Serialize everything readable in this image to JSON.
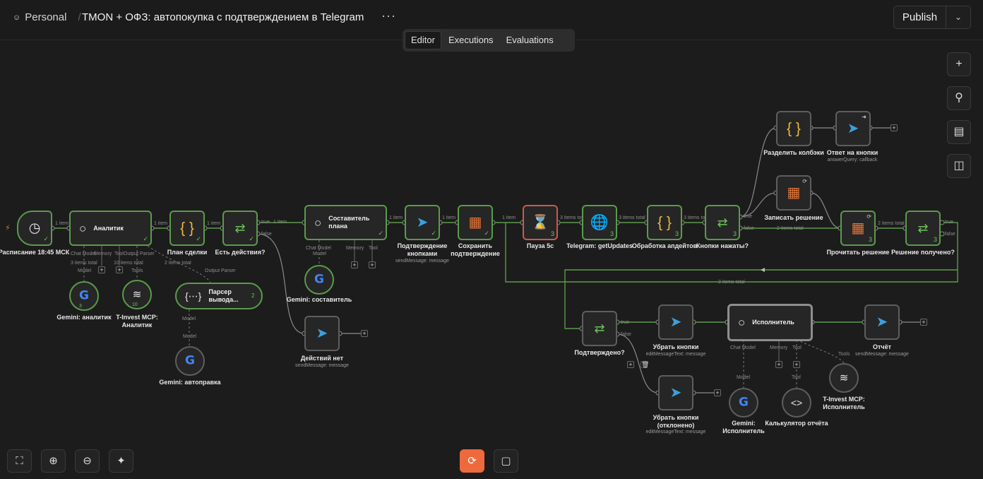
{
  "header": {
    "workspace": "Personal",
    "title": "TMON + ОФЗ: автопокупка с подтверждением в Telegram",
    "more": "···",
    "publish": "Publish",
    "publish_menu": "⌄"
  },
  "tabs": [
    {
      "label": "Editor",
      "active": true
    },
    {
      "label": "Executions",
      "active": false
    },
    {
      "label": "Evaluations",
      "active": false
    }
  ],
  "nodes": {
    "schedule": {
      "label": "Расписание 18:45 МСК"
    },
    "analyst": {
      "label": "Аналитик",
      "p1": "Chat Model",
      "p2": "Memory",
      "p3": "Tool",
      "p4": "Output Parser"
    },
    "plan": {
      "label": "План сделки"
    },
    "has_actions": {
      "label": "Есть действия?"
    },
    "gemini_analyst": {
      "label": "Gemini: аналитик",
      "count": "3"
    },
    "tinvest_analyst": {
      "label": "T-Invest MCP:",
      "label2": "Аналитик",
      "count": "10"
    },
    "parser": {
      "label": "Парсер",
      "label2": "вывода...",
      "count": "2",
      "p1": "Model"
    },
    "gemini_autofix": {
      "label": "Gemini: автоправка"
    },
    "composer": {
      "label": "Составитель",
      "label2": "плана",
      "p1": "Chat Model",
      "p2": "Memory",
      "p3": "Tool"
    },
    "gemini_composer": {
      "label": "Gemini: составитель"
    },
    "no_actions": {
      "label": "Действий нет",
      "sub": "sendMessage: message"
    },
    "confirm_buttons": {
      "label": "Подтверждение",
      "label2": "кнопками",
      "sub": "sendMessage: message"
    },
    "save_confirm": {
      "label": "Сохранить",
      "label2": "подтверждение"
    },
    "pause": {
      "label": "Пауза 5с",
      "count": "3"
    },
    "get_updates": {
      "label": "Telegram: getUpdates",
      "count": "3"
    },
    "process_updates": {
      "label": "Обработка апдейтов",
      "count": "3"
    },
    "buttons_pressed": {
      "label": "Кнопки нажаты?",
      "count": "3"
    },
    "split_callbacks": {
      "label": "Разделить колбэки"
    },
    "answer_buttons": {
      "label": "Ответ на кнопки",
      "sub": "answerQuery: callback"
    },
    "write_decision": {
      "label": "Записать решение"
    },
    "read_decision": {
      "label": "Прочитать решение",
      "count": "3"
    },
    "decision_received": {
      "label": "Решение получено?",
      "count": "3"
    },
    "confirmed": {
      "label": "Подтверждено?"
    },
    "remove_buttons": {
      "label": "Убрать кнопки",
      "sub": "editMessageText: message"
    },
    "remove_buttons_rejected": {
      "label": "Убрать кнопки",
      "label2": "(отклонено)",
      "sub": "editMessageText: message"
    },
    "executor": {
      "label": "Исполнитель",
      "p1": "Chat Model",
      "p2": "Memory",
      "p3": "Tool"
    },
    "report": {
      "label": "Отчёт",
      "sub": "sendMessage: message"
    },
    "gemini_executor": {
      "label": "Gemini:",
      "label2": "Исполнитель"
    },
    "report_calc": {
      "label": "Калькулятор отчёта"
    },
    "tinvest_executor": {
      "label": "T-Invest MCP:",
      "label2": "Исполнитель"
    }
  },
  "edge_labels": {
    "item1": "1 item",
    "items3": "3 items total",
    "items10": "10 items total",
    "items2": "2 items total",
    "true": "true",
    "false": "false",
    "model": "Model",
    "tools": "Tools",
    "tool": "Tool",
    "output_parser": "Output Parser",
    "chat_model": "Chat Model",
    "memory": "Memory"
  },
  "icons": {
    "schedule": "clock-icon",
    "agent": "robot-icon",
    "code": "braces-icon",
    "if": "branch-icon",
    "telegram": "telegram-icon",
    "sheet": "table-icon",
    "wait": "hourglass-icon",
    "http": "globe-icon",
    "google": "google-icon",
    "mcp": "mcp-icon",
    "calc": "code-brackets-icon"
  },
  "colors": {
    "success": "#5a9b4a",
    "accent": "#ee6a3c",
    "telegram": "#3aa0dc",
    "sheet": "#e2763a",
    "code": "#f0b63a",
    "wait_border": "#c95a4c"
  }
}
